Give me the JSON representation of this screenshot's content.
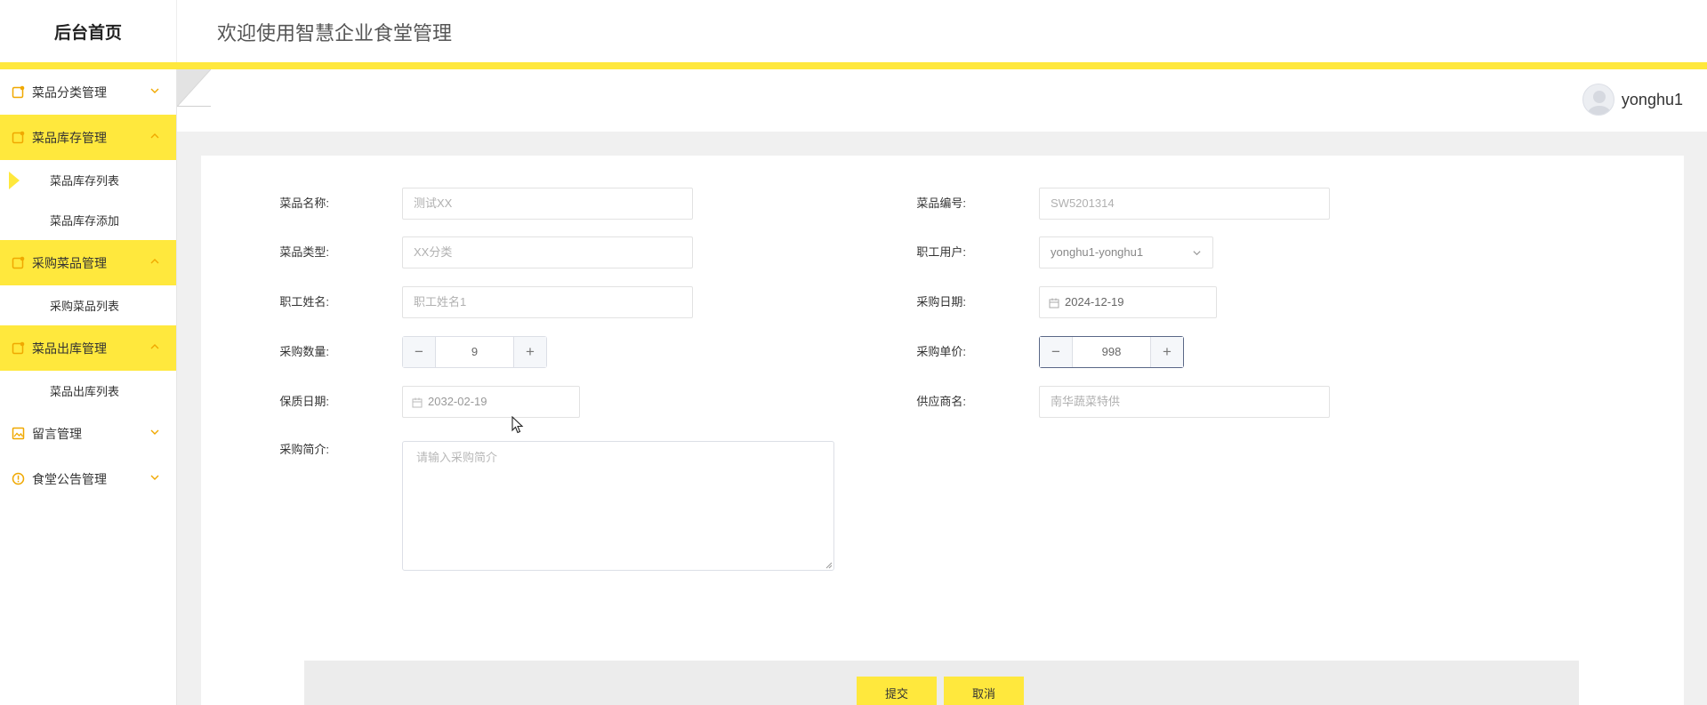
{
  "header": {
    "brand": "后台首页",
    "title": "欢迎使用智慧企业食堂管理"
  },
  "sidebar": {
    "groups": [
      {
        "label": "菜品分类管理",
        "icon": "calendar-edit-icon",
        "expanded": false,
        "items": []
      },
      {
        "label": "菜品库存管理",
        "icon": "calendar-edit-icon",
        "expanded": true,
        "items": [
          "菜品库存列表",
          "菜品库存添加"
        ]
      },
      {
        "label": "采购菜品管理",
        "icon": "calendar-edit-icon",
        "expanded": true,
        "items": [
          "采购菜品列表"
        ]
      },
      {
        "label": "菜品出库管理",
        "icon": "calendar-edit-icon",
        "expanded": true,
        "items": [
          "菜品出库列表"
        ]
      },
      {
        "label": "留言管理",
        "icon": "picture-icon",
        "expanded": false,
        "items": []
      },
      {
        "label": "食堂公告管理",
        "icon": "info-circle-icon",
        "expanded": false,
        "items": []
      }
    ],
    "active_item": "菜品库存列表"
  },
  "user": {
    "name": "yonghu1"
  },
  "form": {
    "dish_name": {
      "label": "菜品名称:",
      "placeholder": "测试XX"
    },
    "dish_code": {
      "label": "菜品编号:",
      "placeholder": "SW5201314"
    },
    "dish_type": {
      "label": "菜品类型:",
      "placeholder": "XX分类"
    },
    "staff_user": {
      "label": "职工用户:",
      "value": "yonghu1-yonghu1"
    },
    "staff_name": {
      "label": "职工姓名:",
      "placeholder": "职工姓名1"
    },
    "purchase_date": {
      "label": "采购日期:",
      "value": "2024-12-19"
    },
    "purchase_qty": {
      "label": "采购数量:",
      "value": "9"
    },
    "unit_price": {
      "label": "采购单价:",
      "value": "998"
    },
    "expiry_date": {
      "label": "保质日期:",
      "value": "2032-02-19"
    },
    "supplier": {
      "label": "供应商名:",
      "placeholder": "南华蔬菜特供"
    },
    "intro": {
      "label": "采购简介:",
      "placeholder": "请输入采购简介"
    },
    "submit_label": "提交",
    "cancel_label": "取消"
  },
  "colors": {
    "accent": "#ffe83d",
    "icon": "#f0a800"
  }
}
